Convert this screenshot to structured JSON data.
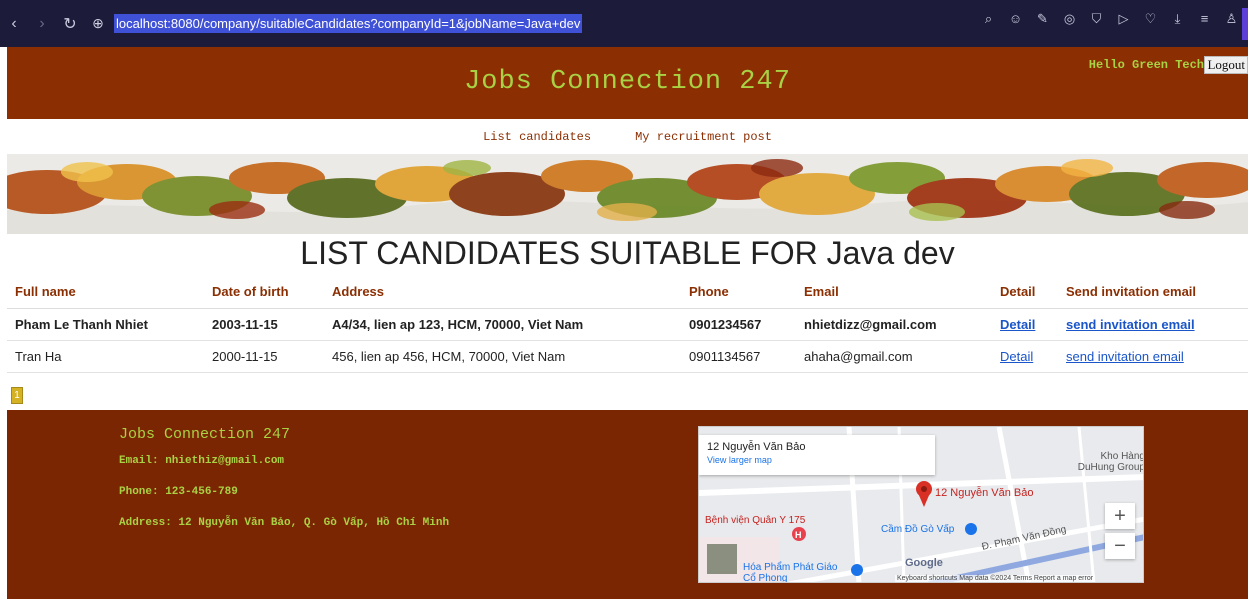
{
  "browser": {
    "url": "localhost:8080/company/suitableCandidates?companyId=1&jobName=Java+dev"
  },
  "header": {
    "title": "Jobs Connection 247",
    "greeting": "Hello Green Tech",
    "logout_label": "Logout"
  },
  "menu": {
    "items": [
      "List candidates",
      "My recruitment post"
    ]
  },
  "page_heading": "LIST CANDIDATES SUITABLE FOR Java dev",
  "table": {
    "columns": [
      "Full name",
      "Date of birth",
      "Address",
      "Phone",
      "Email",
      "Detail",
      "Send invitation email"
    ],
    "rows": [
      {
        "name": "Pham Le Thanh Nhiet",
        "dob": "2003-11-15",
        "address": "A4/34, lien ap 123, HCM, 70000, Viet Nam",
        "phone": "0901234567",
        "email": "nhietdizz@gmail.com",
        "detail": "Detail",
        "invite": "send invitation email"
      },
      {
        "name": "Tran Ha",
        "dob": "2000-11-15",
        "address": "456, lien ap 456, HCM, 70000, Viet Nam",
        "phone": "0901134567",
        "email": "ahaha@gmail.com",
        "detail": "Detail",
        "invite": "send invitation email"
      }
    ]
  },
  "pagination": {
    "current": "1"
  },
  "footer": {
    "title": "Jobs Connection 247",
    "email": "Email: nhiethiz@gmail.com",
    "phone": "Phone: 123-456-789",
    "address": "Address: 12 Nguyễn Văn Bảo, Q. Gò Vấp, Hồ Chí Minh"
  },
  "map": {
    "place": "12 Nguyễn Văn Bảo",
    "larger_map": "View larger map",
    "pin_label": "12 Nguyễn Văn Bảo",
    "labels": [
      "Kho Hàng DuHung Group",
      "Bệnh viện Quân Y 175",
      "Cầm Đồ Gò Vấp",
      "Hóa Phẩm Phát Giáo Cổ Phong",
      "Đ. Phạm Văn Đồng"
    ],
    "zoom_in": "+",
    "zoom_out": "−",
    "footer": "Keyboard shortcuts   Map data ©2024   Terms   Report a map error",
    "google": "Google"
  },
  "icons": [
    "back-icon",
    "forward-icon",
    "reload-icon",
    "globe-icon",
    "zoom-icon",
    "emoji-icon",
    "edit-icon",
    "camera-icon",
    "shield-icon",
    "play-icon",
    "heart-icon",
    "download-icon",
    "menu-icon",
    "user-icon"
  ],
  "colors": {
    "header_bg": "#8b2f03",
    "footer_bg": "#7b2603",
    "accent_text": "#a9d144",
    "link": "#1a55c9"
  }
}
